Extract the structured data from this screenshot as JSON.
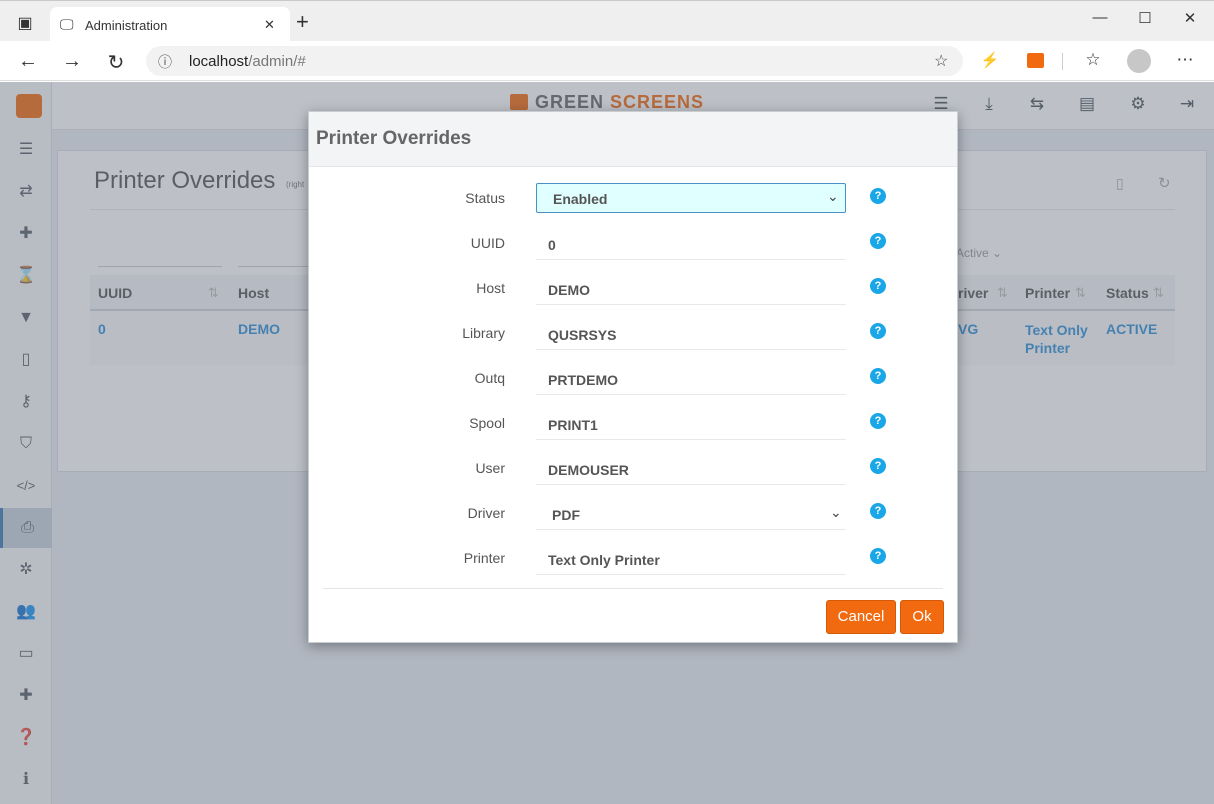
{
  "browser": {
    "tab_title": "Administration",
    "url_host": "localhost",
    "url_path": "/admin/#",
    "new_tab": "+",
    "tab_close": "✕",
    "win_min": "—",
    "win_max": "☐",
    "win_close": "✕"
  },
  "app": {
    "brand_green": "GREEN",
    "brand_screens": "SCREENS",
    "page_title": "Printer Overrides",
    "page_subtitle": "(right",
    "filter_active": "Active",
    "table": {
      "headers": [
        "UUID",
        "Host",
        "river",
        "Printer",
        "Status"
      ],
      "row": {
        "uuid": "0",
        "host": "DEMO",
        "driver": "VG",
        "printer": "Text Only Printer",
        "status": "ACTIVE"
      }
    }
  },
  "modal": {
    "title": "Printer Overrides",
    "fields": [
      {
        "label": "Status",
        "value": "Enabled",
        "type": "select"
      },
      {
        "label": "UUID",
        "value": "0"
      },
      {
        "label": "Host",
        "value": "DEMO"
      },
      {
        "label": "Library",
        "value": "QUSRSYS"
      },
      {
        "label": "Outq",
        "value": "PRTDEMO"
      },
      {
        "label": "Spool",
        "value": "PRINT1"
      },
      {
        "label": "User",
        "value": "DEMOUSER"
      },
      {
        "label": "Driver",
        "value": "PDF",
        "type": "select"
      },
      {
        "label": "Printer",
        "value": "Text Only Printer"
      }
    ],
    "help_glyph": "?",
    "cancel_label": "Cancel",
    "ok_label": "Ok"
  },
  "colors": {
    "accent": "#f26a0f",
    "help": "#1aa7e8",
    "select_bg": "#e0ffff"
  }
}
